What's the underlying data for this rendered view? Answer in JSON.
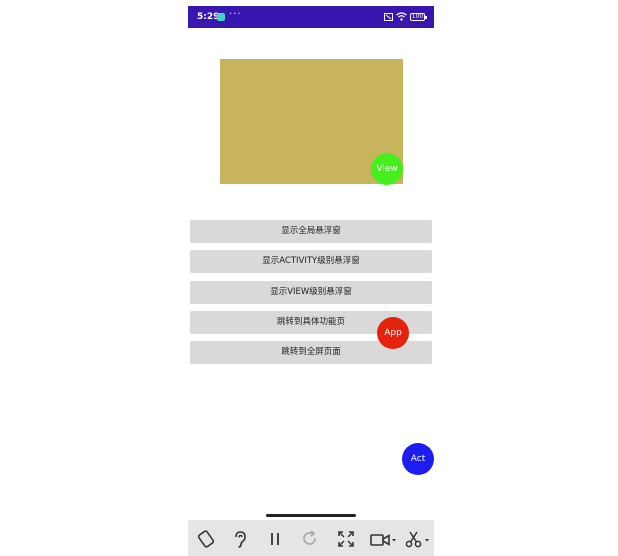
{
  "status_bar": {
    "time": "5:29",
    "dots": "···",
    "battery": "100"
  },
  "floating": {
    "view_label": "View",
    "app_label": "App",
    "act_label": "Act"
  },
  "buttons": [
    {
      "label": "显示全局悬浮窗"
    },
    {
      "label": "显示ACTIVITY级别悬浮窗"
    },
    {
      "label": "显示VIEW级别悬浮窗"
    },
    {
      "label": "跳转到具体功能页"
    },
    {
      "label": "跳转到全屏页面"
    }
  ],
  "colors": {
    "status_bar": "#3817b0",
    "media_box": "#c7b45d",
    "view_fab": "#45ef1e",
    "app_fab": "#e4220d",
    "act_fab": "#1d1df0",
    "button_bg": "#d9d9d9"
  },
  "toolbar": {
    "icons": [
      "rotate-icon",
      "hearing-icon",
      "pause-icon",
      "refresh-icon",
      "fullscreen-icon",
      "video-camera-icon",
      "scissors-icon"
    ]
  }
}
